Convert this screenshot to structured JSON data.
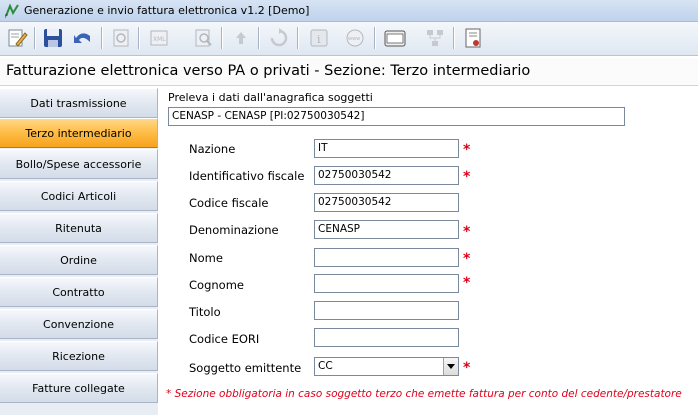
{
  "window": {
    "title": "Generazione e invio fattura elettronica v1.2 [Demo]"
  },
  "toolbar": {
    "buttons": [
      {
        "icon": "edit-icon",
        "enabled": true
      },
      {
        "icon": "save-icon",
        "enabled": true
      },
      {
        "icon": "undo-icon",
        "enabled": true
      },
      {
        "icon": "refresh-doc-icon",
        "enabled": false
      },
      {
        "icon": "xml-icon",
        "enabled": false
      },
      {
        "icon": "preview-icon",
        "enabled": false
      },
      {
        "icon": "upload-icon",
        "enabled": false
      },
      {
        "icon": "reload-icon",
        "enabled": false
      },
      {
        "icon": "info-icon",
        "enabled": false
      },
      {
        "icon": "web-icon",
        "enabled": false
      },
      {
        "icon": "folder-icon",
        "enabled": true
      },
      {
        "icon": "network-icon",
        "enabled": false
      },
      {
        "icon": "certificate-icon",
        "enabled": true
      }
    ]
  },
  "section": {
    "title": "Fatturazione elettronica verso PA o privati - Sezione: Terzo intermediario"
  },
  "sidebar": {
    "items": [
      {
        "label": "Dati trasmissione",
        "active": false
      },
      {
        "label": "Terzo intermediario",
        "active": true
      },
      {
        "label": "Bollo/Spese accessorie",
        "active": false
      },
      {
        "label": "Codici Articoli",
        "active": false
      },
      {
        "label": "Ritenuta",
        "active": false
      },
      {
        "label": "Ordine",
        "active": false
      },
      {
        "label": "Contratto",
        "active": false
      },
      {
        "label": "Convenzione",
        "active": false
      },
      {
        "label": "Ricezione",
        "active": false
      },
      {
        "label": "Fatture collegate",
        "active": false
      }
    ]
  },
  "form": {
    "preleva_label": "Preleva i dati dall'anagrafica soggetti",
    "anagrafica_value": "CENASP - CENASP [PI:02750030542]",
    "required_mark": "*",
    "fields": [
      {
        "label": "Nazione",
        "value": "IT",
        "required": true
      },
      {
        "label": "Identificativo fiscale",
        "value": "02750030542",
        "required": true
      },
      {
        "label": "Codice fiscale",
        "value": "02750030542",
        "required": false
      },
      {
        "label": "Denominazione",
        "value": "CENASP",
        "required": true
      },
      {
        "label": "Nome",
        "value": "",
        "required": true
      },
      {
        "label": "Cognome",
        "value": "",
        "required": true
      },
      {
        "label": "Titolo",
        "value": "",
        "required": false
      },
      {
        "label": "Codice EORI",
        "value": "",
        "required": false
      }
    ],
    "soggetto_label": "Soggetto emittente",
    "soggetto_value": "CC",
    "soggetto_required": true,
    "note": "* Sezione obbligatoria in caso soggetto terzo che emette fattura per conto del cedente/prestatore"
  },
  "colors": {
    "required": "#e0001a",
    "active_tab": "#ffbf4a"
  }
}
